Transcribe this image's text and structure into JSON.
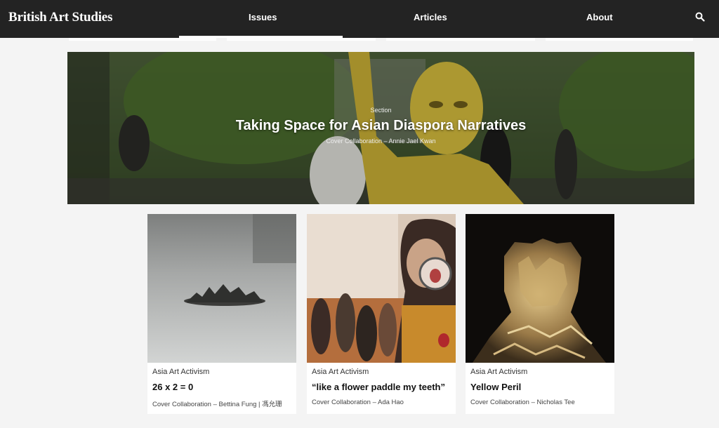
{
  "header": {
    "logo": "British Art Studies",
    "nav": {
      "issues": "Issues",
      "articles": "Articles",
      "about": "About"
    },
    "search_icon": "search-icon"
  },
  "hero": {
    "kicker": "Section",
    "title": "Taking Space for Asian Diaspora Narratives",
    "credit": "Cover Collaboration – Annie Jael Kwan"
  },
  "cards": [
    {
      "category": "Asia Art Activism",
      "title": "26 x 2 = 0",
      "credit": "Cover Collaboration – Bettina Fung | 馮允珊"
    },
    {
      "category": "Asia Art Activism",
      "title": "“like a flower paddle my teeth”",
      "credit": "Cover Collaboration – Ada Hao"
    },
    {
      "category": "Asia Art Activism",
      "title": "Yellow Peril",
      "credit": "Cover Collaboration – Nicholas Tee"
    }
  ],
  "colors": {
    "header_bg": "#232323",
    "page_bg": "#f4f4f4"
  }
}
